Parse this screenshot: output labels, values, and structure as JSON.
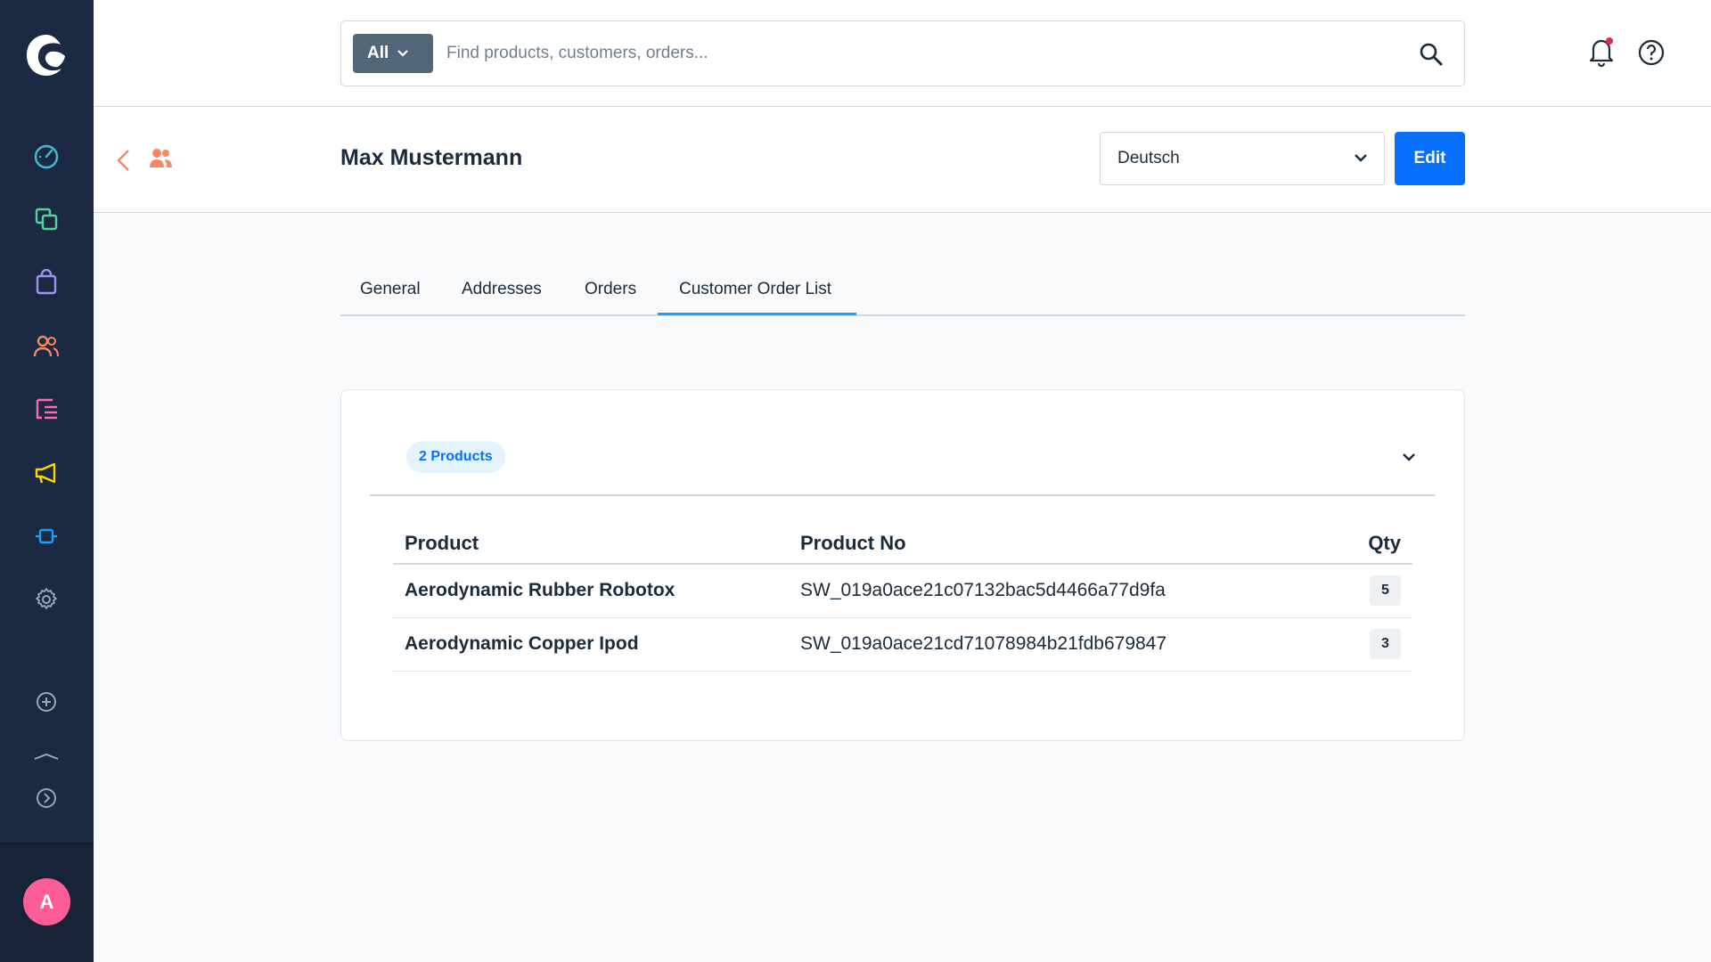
{
  "colors": {
    "sidebar": "#1b2a42",
    "primary": "#0870ff",
    "avatar": "#ff5d96",
    "tab_active": "#189eff",
    "module_customers": "#f88962"
  },
  "sidebar": {
    "items": [
      {
        "icon": "dashboard-icon",
        "color": "#40bdd6"
      },
      {
        "icon": "catalog-icon",
        "color": "#52d39e"
      },
      {
        "icon": "orders-icon",
        "color": "#a092f0"
      },
      {
        "icon": "customers-icon",
        "color": "#f88962"
      },
      {
        "icon": "content-icon",
        "color": "#ff68b4"
      },
      {
        "icon": "marketing-icon",
        "color": "#ffd700"
      },
      {
        "icon": "extensions-icon",
        "color": "#189eff"
      },
      {
        "icon": "settings-icon",
        "color": "#9aa8b5"
      },
      {
        "icon": "add-icon",
        "color": "#9aa8b5"
      },
      {
        "icon": "expand-icon",
        "color": "#9aa8b5"
      }
    ],
    "avatar_initial": "A"
  },
  "search": {
    "type_label": "All",
    "placeholder": "Find products, customers, orders..."
  },
  "header": {
    "title": "Max Mustermann",
    "language": "Deutsch",
    "edit_label": "Edit"
  },
  "tabs": [
    {
      "label": "General"
    },
    {
      "label": "Addresses"
    },
    {
      "label": "Orders"
    },
    {
      "label": "Customer Order List",
      "active": true
    }
  ],
  "order_list": {
    "badge": "2 Products",
    "columns": {
      "product": "Product",
      "product_no": "Product No",
      "qty": "Qty"
    },
    "rows": [
      {
        "product": "Aerodynamic Rubber Robotox",
        "product_no": "SW_019a0ace21c07132bac5d4466a77d9fa",
        "qty": "5"
      },
      {
        "product": "Aerodynamic Copper Ipod",
        "product_no": "SW_019a0ace21cd71078984b21fdb679847",
        "qty": "3"
      }
    ]
  }
}
